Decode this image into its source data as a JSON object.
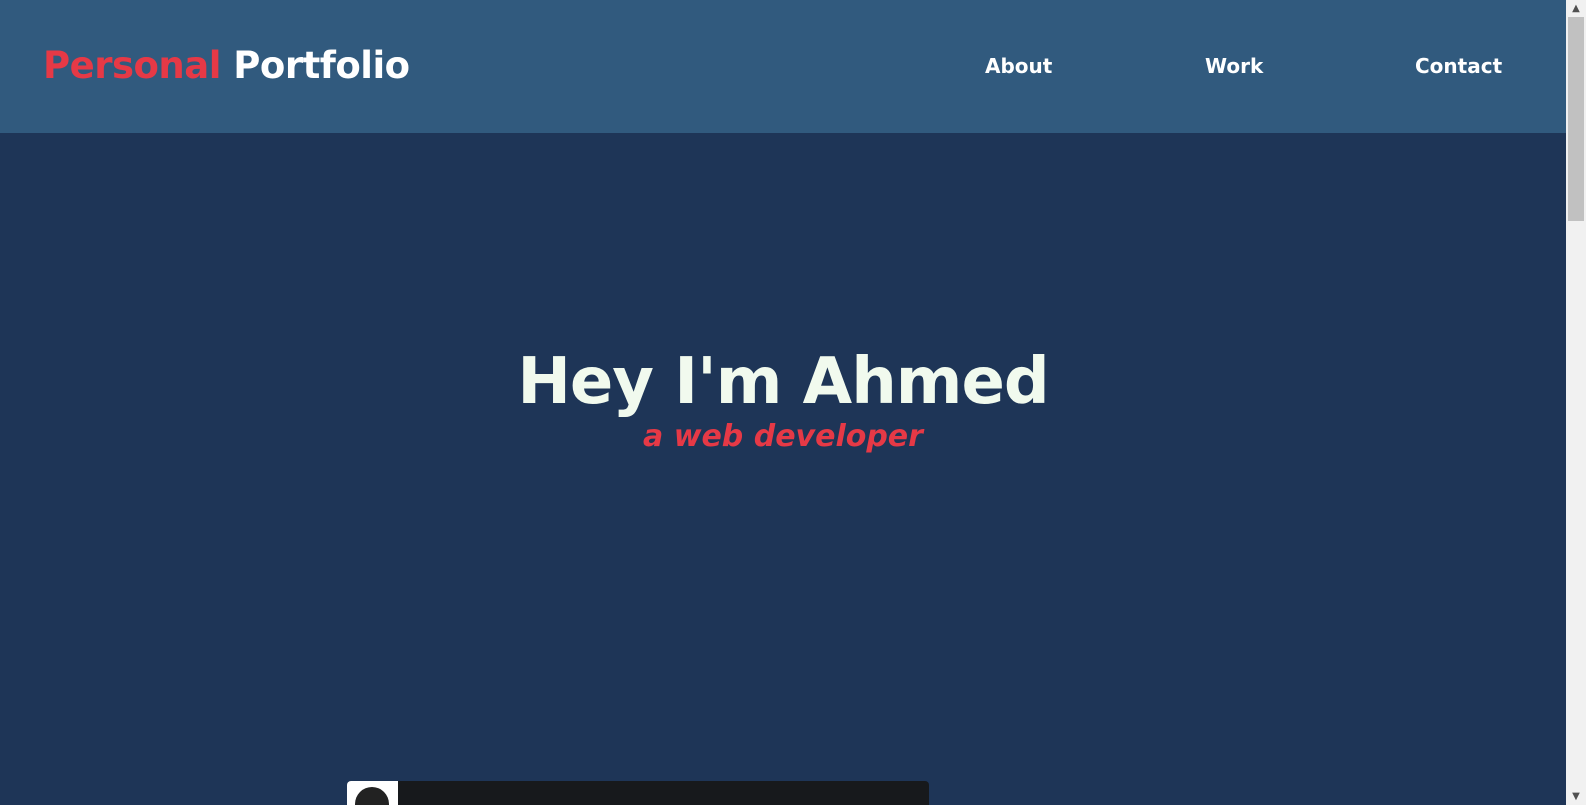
{
  "nav": {
    "brand_accent": "Personal",
    "brand_main": "Portfolio",
    "links": [
      {
        "label": "About"
      },
      {
        "label": "Work"
      },
      {
        "label": "Contact"
      }
    ]
  },
  "hero": {
    "title": "Hey I'm Ahmed",
    "subtitle": "a web developer"
  },
  "colors": {
    "navbar_bg": "#315a7e",
    "page_bg": "#1e3557",
    "accent": "#e63946",
    "title_text": "#f1faee"
  },
  "scrollbar": {
    "up_icon": "chevron-up-icon",
    "down_icon": "chevron-down-icon"
  }
}
